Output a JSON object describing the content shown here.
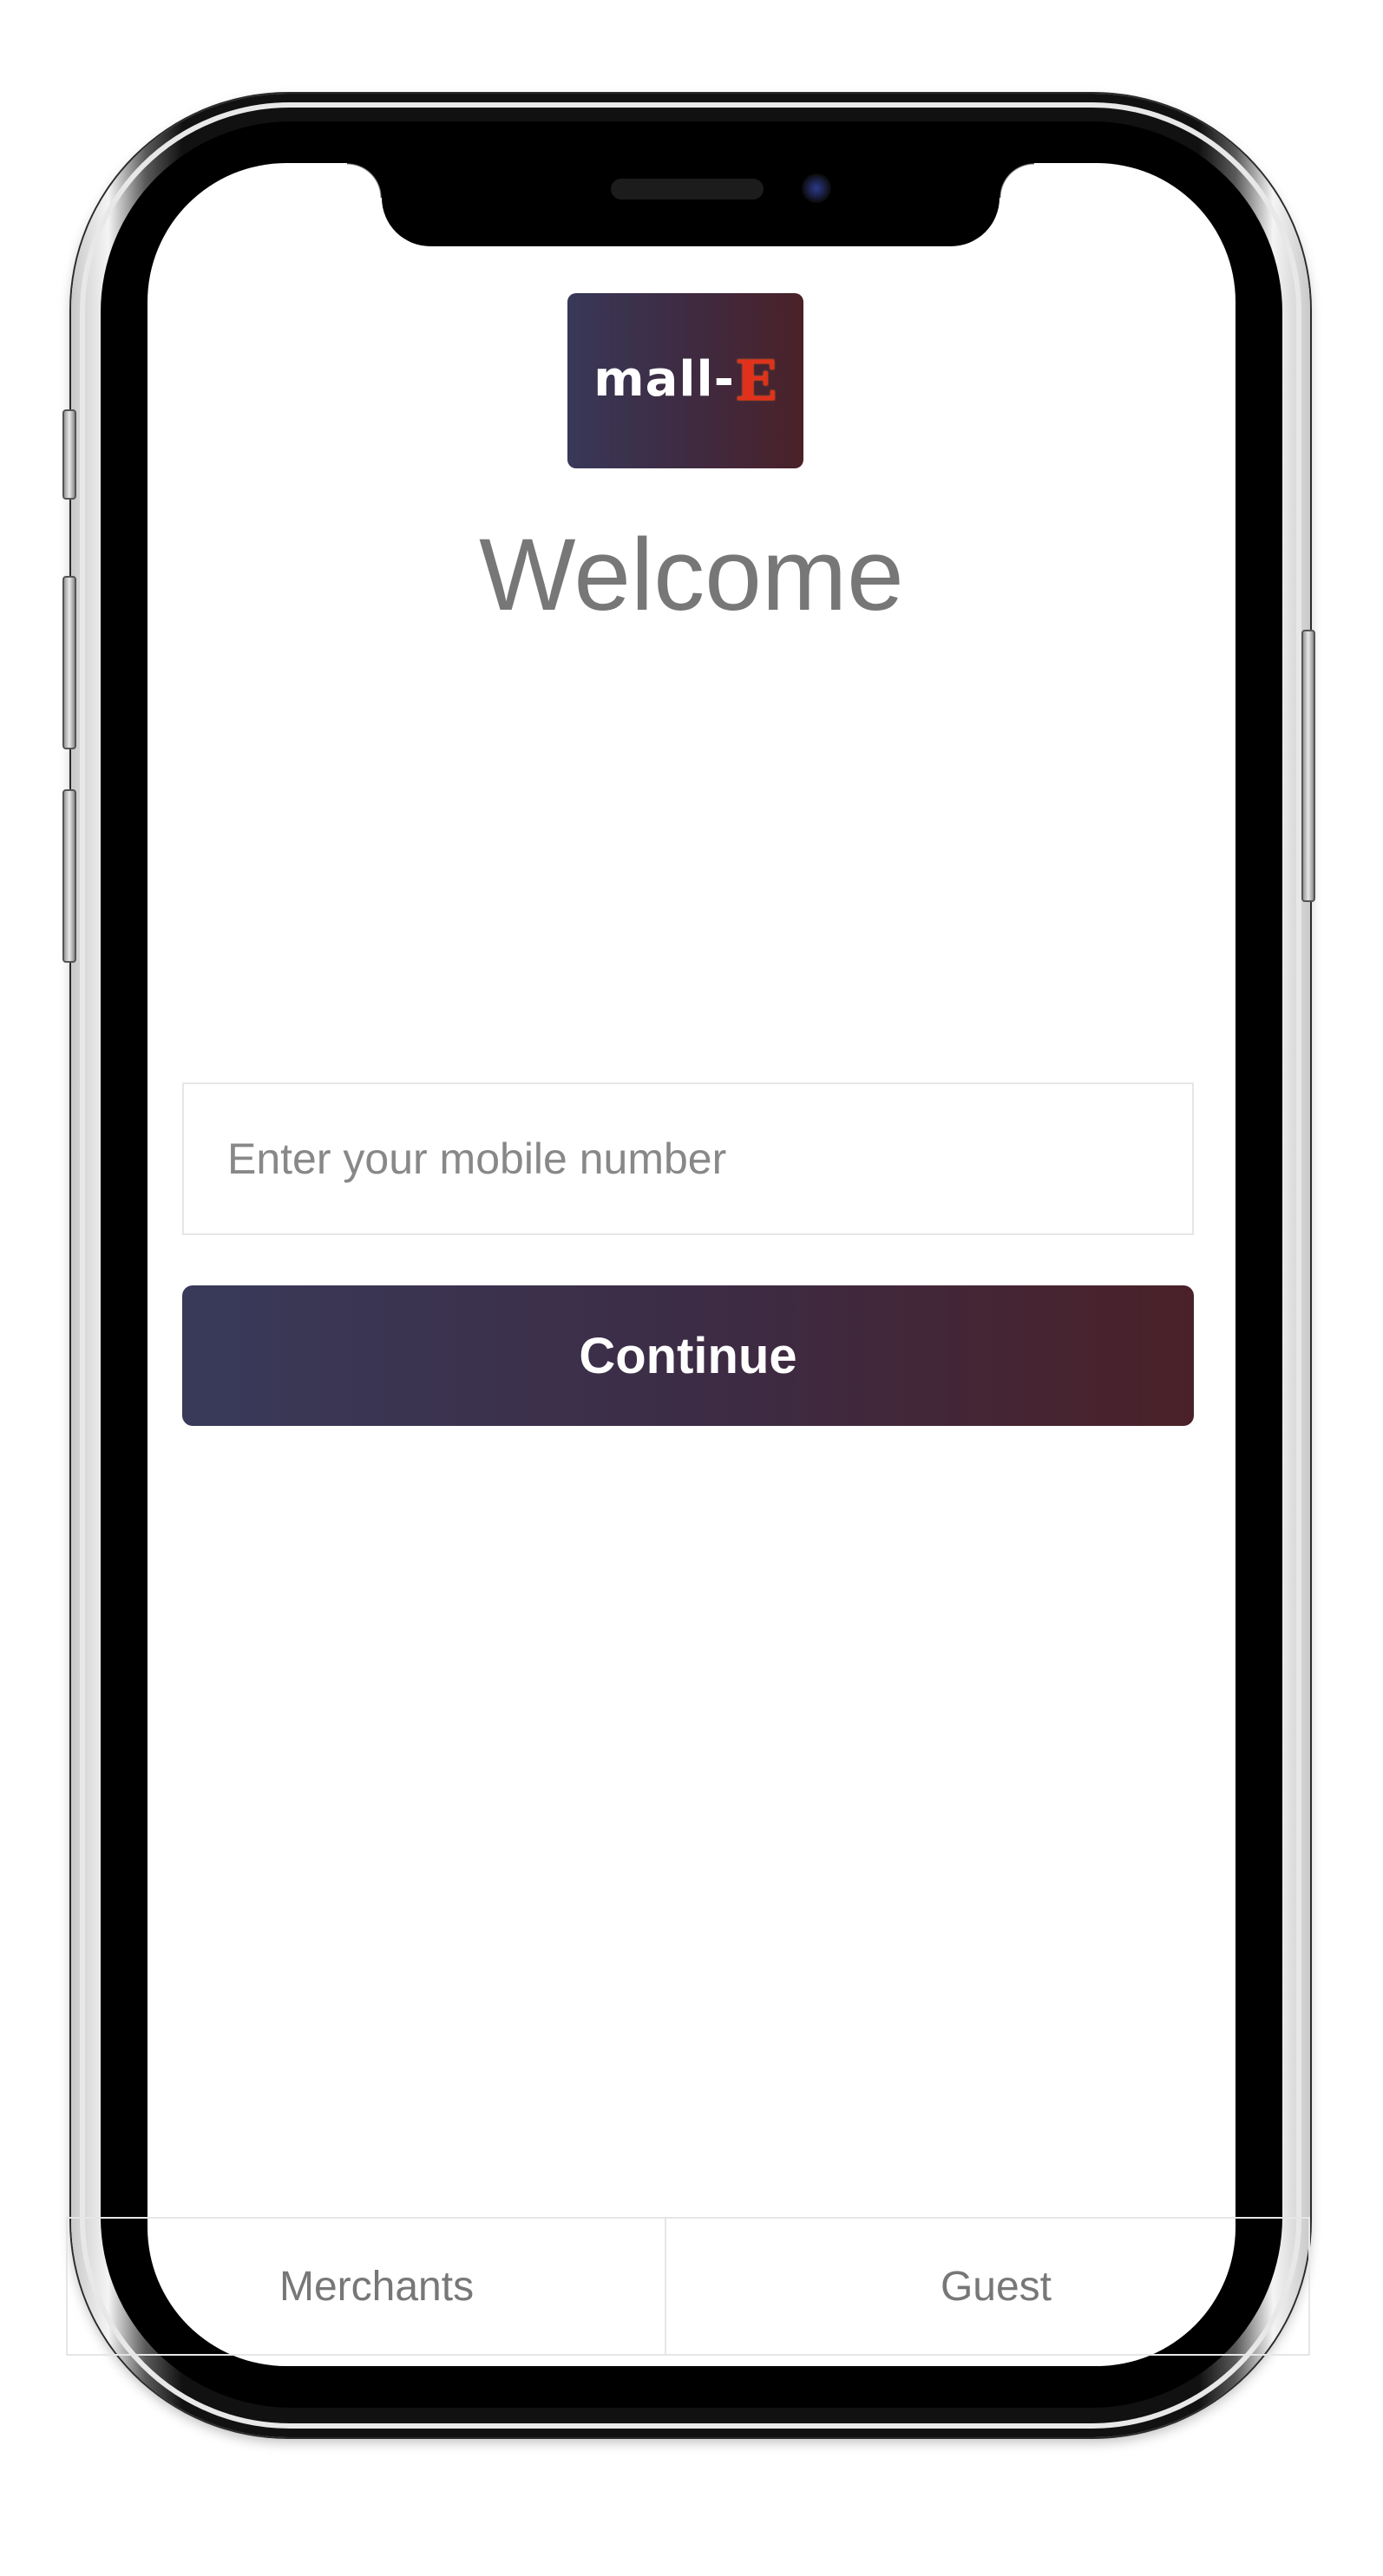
{
  "app": {
    "logo_text": "mall-",
    "logo_accent": "E",
    "welcome_title": "Welcome"
  },
  "form": {
    "mobile_placeholder": "Enter your mobile number",
    "mobile_value": "",
    "continue_label": "Continue"
  },
  "bottom_tabs": [
    {
      "label": "Merchants"
    },
    {
      "label": "Guest"
    }
  ],
  "colors": {
    "brand_gradient_start": "#383858",
    "brand_gradient_end": "#4a2128",
    "logo_accent": "#e1311d",
    "text_muted": "#777777"
  }
}
